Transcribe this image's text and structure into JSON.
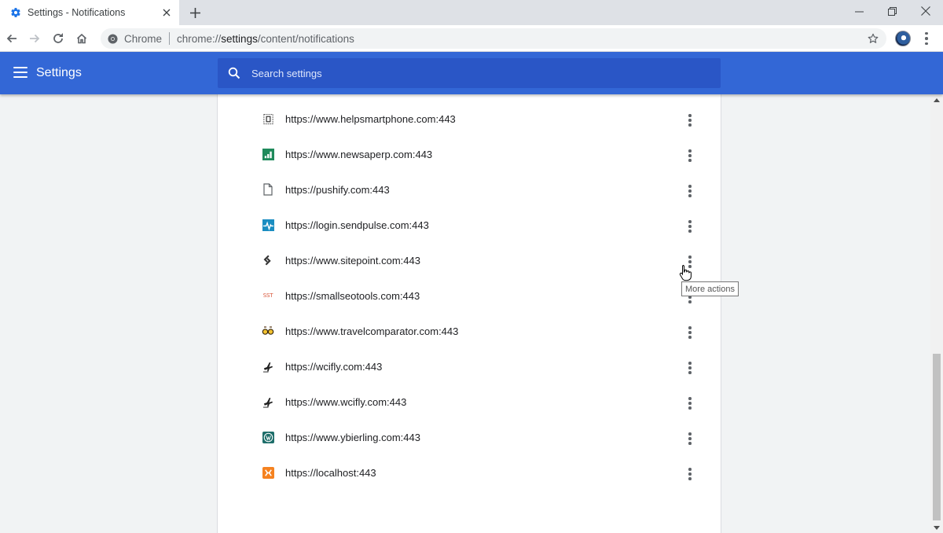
{
  "tab": {
    "title": "Settings - Notifications",
    "close_label": "✕"
  },
  "new_tab_label": "+",
  "window_controls": {
    "minimize": "—",
    "restore": "❐",
    "close": "✕"
  },
  "omnibox": {
    "chip": "Chrome",
    "url_scheme": "chrome://",
    "url_host": "settings",
    "url_path": "/content/notifications"
  },
  "header": {
    "title": "Settings",
    "search_placeholder": "Search settings"
  },
  "sites": [
    {
      "url": "https://www.helpsmartphone.com:443",
      "icon": "helpsmartphone-favicon"
    },
    {
      "url": "https://www.newsaperp.com:443",
      "icon": "newsaperp-favicon"
    },
    {
      "url": "https://pushify.com:443",
      "icon": "generic-page-favicon"
    },
    {
      "url": "https://login.sendpulse.com:443",
      "icon": "sendpulse-favicon"
    },
    {
      "url": "https://www.sitepoint.com:443",
      "icon": "sitepoint-favicon"
    },
    {
      "url": "https://smallseotools.com:443",
      "icon": "smallseotools-favicon",
      "icon_text": "SST"
    },
    {
      "url": "https://www.travelcomparator.com:443",
      "icon": "travelcomparator-favicon"
    },
    {
      "url": "https://wcifly.com:443",
      "icon": "plane-favicon"
    },
    {
      "url": "https://www.wcifly.com:443",
      "icon": "plane-favicon"
    },
    {
      "url": "https://www.ybierling.com:443",
      "icon": "wordpress-favicon"
    },
    {
      "url": "https://localhost:443",
      "icon": "xampp-favicon"
    }
  ],
  "tooltip": "More actions",
  "colors": {
    "header": "#3367d6",
    "search": "#2a56c6",
    "background": "#f1f3f4"
  }
}
